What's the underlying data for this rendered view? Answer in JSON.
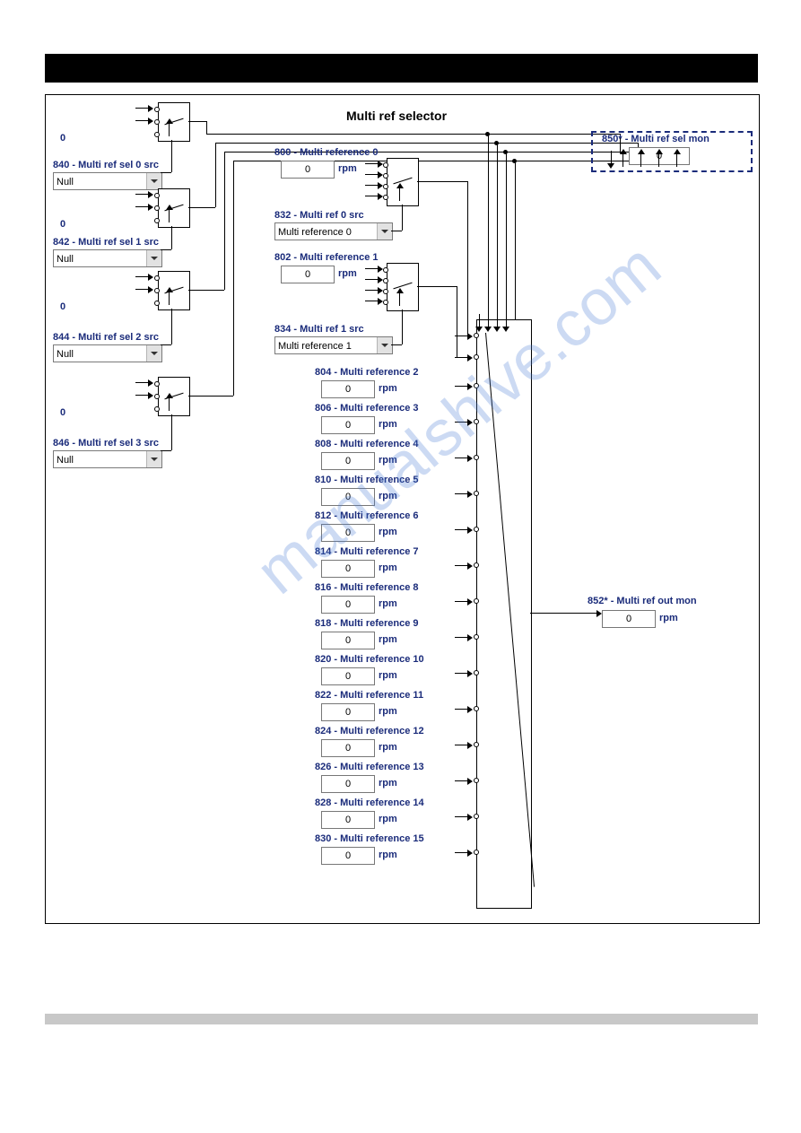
{
  "title": "Multi ref selector",
  "sel_src": [
    {
      "id": "840",
      "label": "840 - Multi ref sel 0 src",
      "value": "Null"
    },
    {
      "id": "842",
      "label": "842 - Multi ref sel 1 src",
      "value": "Null"
    },
    {
      "id": "844",
      "label": "844 - Multi ref sel 2 src",
      "value": "Null"
    },
    {
      "id": "846",
      "label": "846 - Multi ref sel 3 src",
      "value": "Null"
    }
  ],
  "ref_src": [
    {
      "id": "832",
      "label": "832 - Multi ref 0 src",
      "value": "Multi reference 0"
    },
    {
      "id": "834",
      "label": "834 - Multi ref 1 src",
      "value": "Multi reference 1"
    }
  ],
  "refs": [
    {
      "id": "800",
      "label": "800 - Multi reference 0",
      "value": "0",
      "unit": "rpm"
    },
    {
      "id": "802",
      "label": "802 - Multi reference 1",
      "value": "0",
      "unit": "rpm"
    },
    {
      "id": "804",
      "label": "804 - Multi reference 2",
      "value": "0",
      "unit": "rpm"
    },
    {
      "id": "806",
      "label": "806 - Multi reference 3",
      "value": "0",
      "unit": "rpm"
    },
    {
      "id": "808",
      "label": "808 - Multi reference 4",
      "value": "0",
      "unit": "rpm"
    },
    {
      "id": "810",
      "label": "810 - Multi reference 5",
      "value": "0",
      "unit": "rpm"
    },
    {
      "id": "812",
      "label": "812 - Multi reference 6",
      "value": "0",
      "unit": "rpm"
    },
    {
      "id": "814",
      "label": "814 - Multi reference 7",
      "value": "0",
      "unit": "rpm"
    },
    {
      "id": "816",
      "label": "816 - Multi reference 8",
      "value": "0",
      "unit": "rpm"
    },
    {
      "id": "818",
      "label": "818 - Multi reference 9",
      "value": "0",
      "unit": "rpm"
    },
    {
      "id": "820",
      "label": "820 - Multi reference 10",
      "value": "0",
      "unit": "rpm"
    },
    {
      "id": "822",
      "label": "822 - Multi reference 11",
      "value": "0",
      "unit": "rpm"
    },
    {
      "id": "824",
      "label": "824 - Multi reference 12",
      "value": "0",
      "unit": "rpm"
    },
    {
      "id": "826",
      "label": "826 - Multi reference 13",
      "value": "0",
      "unit": "rpm"
    },
    {
      "id": "828",
      "label": "828 - Multi reference 14",
      "value": "0",
      "unit": "rpm"
    },
    {
      "id": "830",
      "label": "830 - Multi reference 15",
      "value": "0",
      "unit": "rpm"
    }
  ],
  "mon_sel": {
    "id": "850",
    "label": "850* - Multi ref sel mon",
    "value": "0"
  },
  "mon_out": {
    "id": "852",
    "label": "852* - Multi ref out mon",
    "value": "0",
    "unit": "rpm"
  },
  "watermark": "manualshive.com"
}
